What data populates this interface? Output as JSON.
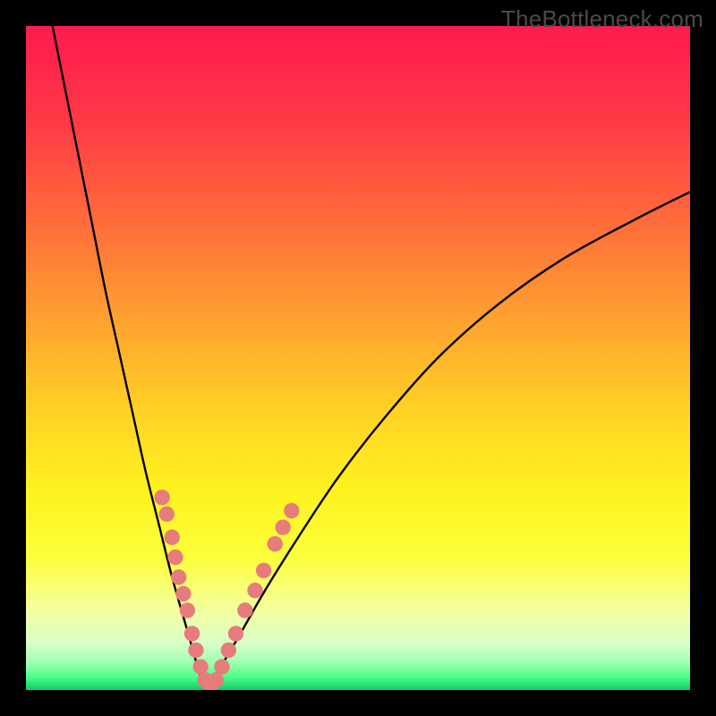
{
  "watermark": "TheBottleneck.com",
  "colors": {
    "gradient_stops": [
      {
        "pct": 0,
        "color": "#ff1a4f"
      },
      {
        "pct": 14,
        "color": "#ff3846"
      },
      {
        "pct": 30,
        "color": "#ff6e3a"
      },
      {
        "pct": 45,
        "color": "#ffa42f"
      },
      {
        "pct": 58,
        "color": "#ffd225"
      },
      {
        "pct": 70,
        "color": "#fff21f"
      },
      {
        "pct": 80,
        "color": "#fcff3b"
      },
      {
        "pct": 88,
        "color": "#f4ffa0"
      },
      {
        "pct": 93,
        "color": "#d8ffc8"
      },
      {
        "pct": 96,
        "color": "#9cffb0"
      },
      {
        "pct": 98,
        "color": "#4dff8a"
      },
      {
        "pct": 100,
        "color": "#12c96a"
      }
    ],
    "curve": "#000000",
    "marker": "#e77c7c"
  },
  "chart_data": {
    "type": "line",
    "title": "",
    "xlabel": "",
    "ylabel": "",
    "xlim": [
      0,
      100
    ],
    "ylim": [
      0,
      100
    ],
    "note": "V-shaped bottleneck curve; minimum near x≈27, y≈0. Left branch starts top-left, right branch rises toward top-right. Pink markers cluster along both branches in the lower ~30% of the y range.",
    "series": [
      {
        "name": "curve-left",
        "x": [
          4,
          6,
          8,
          10,
          12,
          14,
          16,
          18,
          20,
          22,
          24,
          26,
          27
        ],
        "y": [
          100,
          90,
          80,
          70,
          60,
          51,
          42,
          33,
          25,
          17,
          10,
          3,
          0
        ]
      },
      {
        "name": "curve-right",
        "x": [
          27,
          29,
          32,
          36,
          41,
          47,
          54,
          62,
          71,
          81,
          92,
          100
        ],
        "y": [
          0,
          3,
          8,
          15,
          23,
          32,
          41,
          50,
          58,
          65,
          71,
          75
        ]
      }
    ],
    "markers": [
      {
        "x": 20.5,
        "y": 29
      },
      {
        "x": 21.2,
        "y": 26.5
      },
      {
        "x": 22.0,
        "y": 23
      },
      {
        "x": 22.5,
        "y": 20
      },
      {
        "x": 23.0,
        "y": 17
      },
      {
        "x": 23.7,
        "y": 14.5
      },
      {
        "x": 24.3,
        "y": 12
      },
      {
        "x": 25.0,
        "y": 8.5
      },
      {
        "x": 25.6,
        "y": 6
      },
      {
        "x": 26.3,
        "y": 3.5
      },
      {
        "x": 27.0,
        "y": 1.5
      },
      {
        "x": 27.8,
        "y": 0.7
      },
      {
        "x": 28.6,
        "y": 1.5
      },
      {
        "x": 29.5,
        "y": 3.5
      },
      {
        "x": 30.5,
        "y": 6
      },
      {
        "x": 31.6,
        "y": 8.5
      },
      {
        "x": 33.0,
        "y": 12
      },
      {
        "x": 34.5,
        "y": 15
      },
      {
        "x": 35.8,
        "y": 18
      },
      {
        "x": 37.5,
        "y": 22
      },
      {
        "x": 38.7,
        "y": 24.5
      },
      {
        "x": 40.0,
        "y": 27
      }
    ]
  }
}
